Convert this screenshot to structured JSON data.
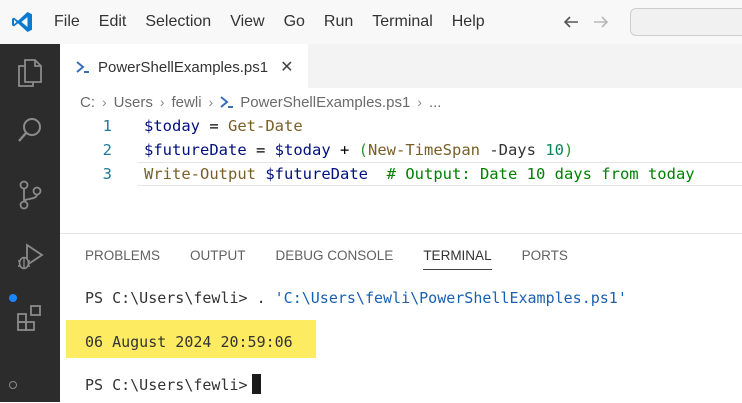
{
  "menu": {
    "items": [
      "File",
      "Edit",
      "Selection",
      "View",
      "Go",
      "Run",
      "Terminal",
      "Help"
    ]
  },
  "icons": {
    "logo": "vscode-logo-icon",
    "back": "arrow-left-icon",
    "forward": "arrow-right-icon",
    "explorer": "files-icon",
    "search": "search-icon",
    "scm": "source-control-icon",
    "debug": "run-debug-icon",
    "extensions": "extensions-icon",
    "powershell": "powershell-icon",
    "close": "close-icon",
    "chevron": "chevron-right-icon"
  },
  "editor": {
    "tab_label": "PowerShellExamples.ps1",
    "tab_close": "✕",
    "breadcrumb": {
      "segments": [
        "C:",
        "Users",
        "fewli"
      ],
      "file": "PowerShellExamples.ps1",
      "more": "..."
    },
    "lines": [
      {
        "num": "1",
        "tokens": {
          "t1": "$today",
          "t2": " = ",
          "t3": "Get-Date"
        }
      },
      {
        "num": "2",
        "tokens": {
          "t1": "$futureDate",
          "t2": " = ",
          "t3": "$today",
          "t4": " + ",
          "t5": "(",
          "t6": "New-TimeSpan",
          "t7": " -Days ",
          "t8": "10",
          "t9": ")"
        }
      },
      {
        "num": "3",
        "tokens": {
          "t1": "Write-Output",
          "t2": " ",
          "t3": "$futureDate",
          "t4": "  ",
          "t5": "# Output: Date 10 days from today"
        }
      }
    ]
  },
  "panel": {
    "tabs": [
      "PROBLEMS",
      "OUTPUT",
      "DEBUG CONSOLE",
      "TERMINAL",
      "PORTS"
    ],
    "active_tab": "TERMINAL",
    "terminal": {
      "line1_prompt": "PS C:\\Users\\fewli> ",
      "line1_cmd": ". ",
      "line1_str": "'C:\\Users\\fewli\\PowerShellExamples.ps1'",
      "output": "06 August 2024 20:59:06",
      "line3_prompt": "PS C:\\Users\\fewli>"
    }
  },
  "colors": {
    "accent_blue": "#007acc",
    "activity_bar": "#2c2c2c",
    "highlight": "#fdeb62"
  }
}
